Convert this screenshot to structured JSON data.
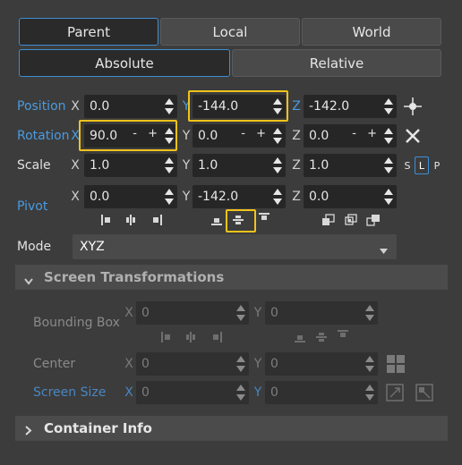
{
  "space_toggle": {
    "parent": "Parent",
    "local": "Local",
    "world": "World"
  },
  "mode_toggle": {
    "absolute": "Absolute",
    "relative": "Relative"
  },
  "rows": {
    "position": {
      "label": "Position",
      "x": "0.0",
      "y": "-144.0",
      "z": "-142.0"
    },
    "rotation": {
      "label": "Rotation",
      "x": "90.0",
      "y": "0.0",
      "z": "0.0",
      "pm": "- +"
    },
    "scale": {
      "label": "Scale",
      "x": "1.0",
      "y": "1.0",
      "z": "1.0",
      "s": "S",
      "l": "L",
      "p": "P"
    },
    "pivot": {
      "label": "Pivot",
      "x": "0.0",
      "y": "-142.0",
      "z": "0.0"
    }
  },
  "axes": {
    "x": "X",
    "y": "Y",
    "z": "Z"
  },
  "mode": {
    "label": "Mode",
    "value": "XYZ"
  },
  "screen_transformations": {
    "title": "Screen Transformations",
    "bounding_box": {
      "label": "Bounding Box",
      "x": "0",
      "y": "0"
    },
    "center": {
      "label": "Center",
      "x": "0",
      "y": "0"
    },
    "screen_size": {
      "label": "Screen Size",
      "x": "0",
      "y": "0"
    }
  },
  "container_info": {
    "title": "Container Info"
  },
  "colors": {
    "accent": "#3d8fd4",
    "highlight": "#f2c31b",
    "blue_label": "#4a9be0",
    "field_bg": "#262626",
    "panel_bg": "#3c3c3c"
  },
  "icons": [
    "crosshair-icon",
    "reset-rotation-icon",
    "align-left-icon",
    "align-center-h-icon",
    "align-right-icon",
    "align-bottom-icon",
    "align-middle-v-icon",
    "align-top-icon",
    "pivot-back-icon",
    "pivot-center-icon",
    "pivot-front-icon",
    "chevron-down-icon",
    "chevron-right-icon",
    "grid-icon",
    "fit-icon",
    "resize-icon"
  ]
}
